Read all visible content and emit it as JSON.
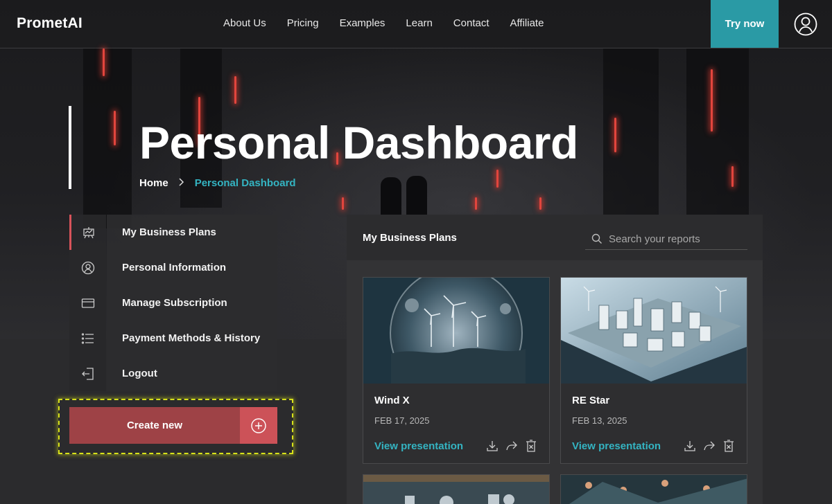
{
  "brand": {
    "logo": "PrometAI"
  },
  "nav": {
    "items": [
      "About Us",
      "Pricing",
      "Examples",
      "Learn",
      "Contact",
      "Affiliate"
    ],
    "cta": "Try now",
    "accent": "#2a9aa5"
  },
  "hero": {
    "title": "Personal Dashboard",
    "breadcrumb": {
      "home": "Home",
      "separator": ">",
      "current": "Personal Dashboard"
    }
  },
  "sidebar": {
    "items": [
      {
        "label": "My Business Plans",
        "icon": "presentation-board-icon",
        "active": true
      },
      {
        "label": "Personal Information",
        "icon": "user-circle-icon",
        "active": false
      },
      {
        "label": "Manage Subscription",
        "icon": "credit-card-icon",
        "active": false
      },
      {
        "label": "Payment Methods & History",
        "icon": "list-icon",
        "active": false
      },
      {
        "label": "Logout",
        "icon": "logout-icon",
        "active": false
      }
    ],
    "create_label": "Create new"
  },
  "main": {
    "title": "My Business Plans",
    "search_placeholder": "Search your reports",
    "cards": [
      {
        "name": "Wind X",
        "date": "FEB 17, 2025",
        "link": "View presentation"
      },
      {
        "name": "RE Star",
        "date": "FEB 13, 2025",
        "link": "View presentation"
      }
    ]
  },
  "colors": {
    "link": "#34b4c2",
    "create": "#9e4246",
    "create_plus": "#cc5258",
    "highlight": "#d8e21a"
  }
}
